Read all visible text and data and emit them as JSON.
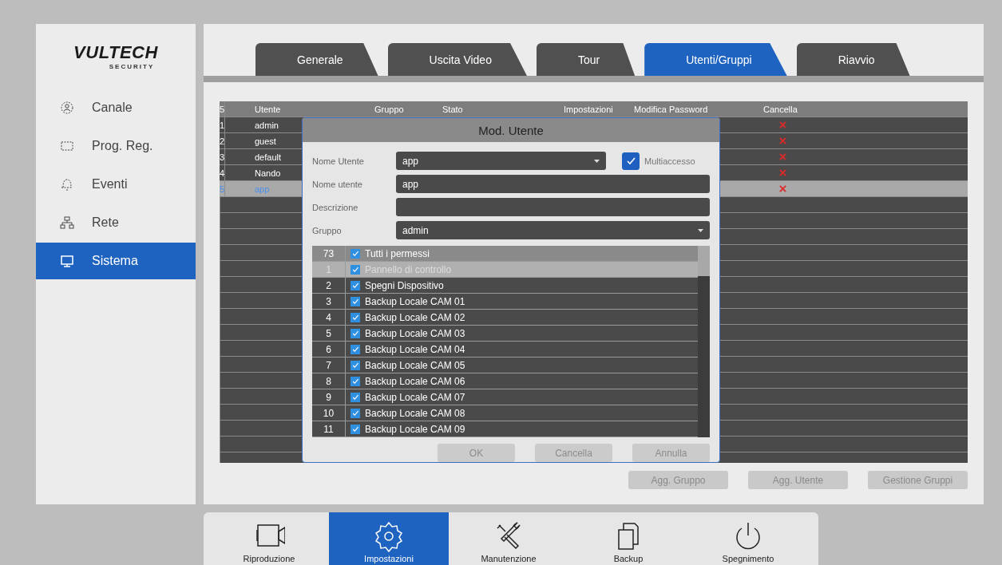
{
  "sidebar": {
    "logo": "VULTECH",
    "logo_tagline": "SECURITY",
    "items": [
      {
        "label": "Canale",
        "selected": false
      },
      {
        "label": "Prog. Reg.",
        "selected": false
      },
      {
        "label": "Eventi",
        "selected": false
      },
      {
        "label": "Rete",
        "selected": false
      },
      {
        "label": "Sistema",
        "selected": true
      }
    ]
  },
  "tabs": [
    {
      "label": "Generale",
      "selected": false
    },
    {
      "label": "Uscita Video",
      "selected": false
    },
    {
      "label": "Tour",
      "selected": false
    },
    {
      "label": "Utenti/Gruppi",
      "selected": true
    },
    {
      "label": "Riavvio",
      "selected": false
    }
  ],
  "users_table": {
    "columns": [
      "5",
      "Utente",
      "Gruppo",
      "Stato",
      "Impostazioni",
      "Modifica Password",
      "Cancella"
    ],
    "rows": [
      {
        "index": "1",
        "name": "admin",
        "selected": false
      },
      {
        "index": "2",
        "name": "guest",
        "selected": false
      },
      {
        "index": "3",
        "name": "default",
        "selected": false
      },
      {
        "index": "4",
        "name": "Nando",
        "selected": false
      },
      {
        "index": "5",
        "name": "app",
        "selected": true
      }
    ]
  },
  "buttons": [
    "Agg. Gruppo",
    "Agg. Utente",
    "Gestione Gruppi"
  ],
  "dialog": {
    "title": "Mod. Utente",
    "fields": [
      {
        "kind": "dropdown",
        "label": "Nome Utente",
        "value": "app"
      },
      {
        "kind": "text",
        "label": "Nome utente",
        "value": "app"
      },
      {
        "kind": "text",
        "label": "Descrizione"
      },
      {
        "kind": "dropdown",
        "label": "Gruppo",
        "value": "admin"
      }
    ],
    "multiaccess": {
      "label": "Multiaccesso",
      "checked": true
    },
    "permissions": [
      {
        "kind": "all",
        "index": "73",
        "label": "Tutti i permessi",
        "checked": true,
        "selected": false
      },
      {
        "kind": "item",
        "index": "1",
        "label": "Pannello di controllo",
        "checked": true,
        "selected": true
      },
      {
        "kind": "item",
        "index": "2",
        "label": "Spegni Dispositivo",
        "checked": true,
        "selected": false
      },
      {
        "kind": "item",
        "index": "3",
        "label": "Backup Locale CAM 01",
        "checked": true,
        "selected": false
      },
      {
        "kind": "item",
        "index": "4",
        "label": "Backup Locale CAM 02",
        "checked": true,
        "selected": false
      },
      {
        "kind": "item",
        "index": "5",
        "label": "Backup Locale CAM 03",
        "checked": true,
        "selected": false
      },
      {
        "kind": "item",
        "index": "6",
        "label": "Backup Locale CAM 04",
        "checked": true,
        "selected": false
      },
      {
        "kind": "item",
        "index": "7",
        "label": "Backup Locale CAM 05",
        "checked": true,
        "selected": false
      },
      {
        "kind": "item",
        "index": "8",
        "label": "Backup Locale CAM 06",
        "checked": true,
        "selected": false
      },
      {
        "kind": "item",
        "index": "9",
        "label": "Backup Locale CAM 07",
        "checked": true,
        "selected": false
      },
      {
        "kind": "item",
        "index": "10",
        "label": "Backup Locale CAM 08",
        "checked": true,
        "selected": false
      },
      {
        "kind": "item",
        "index": "11",
        "label": "Backup Locale CAM 09",
        "checked": true,
        "selected": false
      }
    ],
    "buttons": [
      "OK",
      "Cancella",
      "Annulla"
    ]
  },
  "dock": [
    {
      "label": "Riproduzione",
      "selected": false
    },
    {
      "label": "Impostazioni",
      "selected": true
    },
    {
      "label": "Manutenzione",
      "selected": false
    },
    {
      "label": "Backup",
      "selected": false
    },
    {
      "label": "Spegnimento",
      "selected": false
    }
  ]
}
